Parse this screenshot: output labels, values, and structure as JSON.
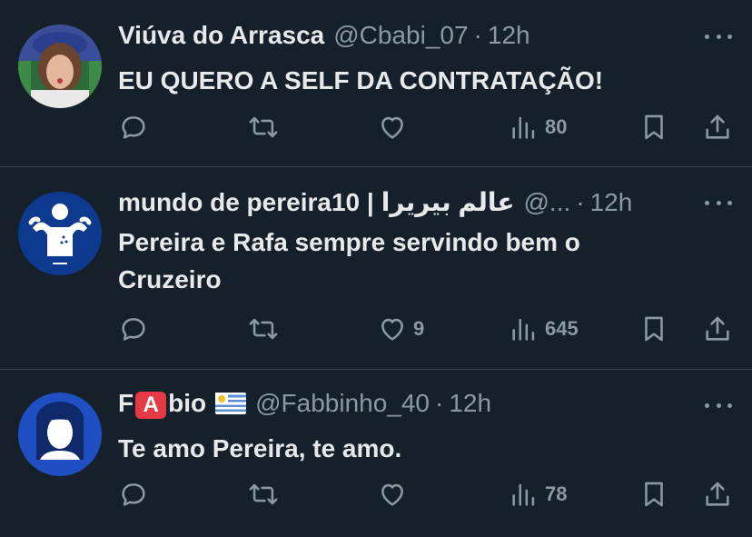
{
  "tweets": [
    {
      "name": "Viúva do Arrasca",
      "handle": "@Cbabi_07",
      "dot": "·",
      "time": "12h",
      "text": "EU QUERO A SELF DA CONTRATAÇÃO!",
      "likes": "",
      "views": "80"
    },
    {
      "name": "mundo de pereira10 | ",
      "name_arabic": "عالم بيريرا",
      "handle": "@...",
      "dot": "·",
      "time": "12h",
      "text": "Pereira e Rafa sempre servindo bem o Cruzeiro",
      "likes": "9",
      "views": "645"
    },
    {
      "name_prefix": "F",
      "name_flag": "A",
      "name_suffix": "bio",
      "handle": "@Fabbinho_40",
      "dot": "·",
      "time": "12h",
      "text": "Te amo Pereira, te amo.",
      "likes": "",
      "views": "78"
    }
  ],
  "icons": [
    "reply-icon",
    "retweet-icon",
    "like-icon",
    "views-icon",
    "bookmark-icon",
    "share-icon",
    "more-icon"
  ],
  "colors": {
    "background": "#15202b",
    "text": "#e7e9ea",
    "muted": "#8b98a5",
    "divider": "#38444d"
  }
}
